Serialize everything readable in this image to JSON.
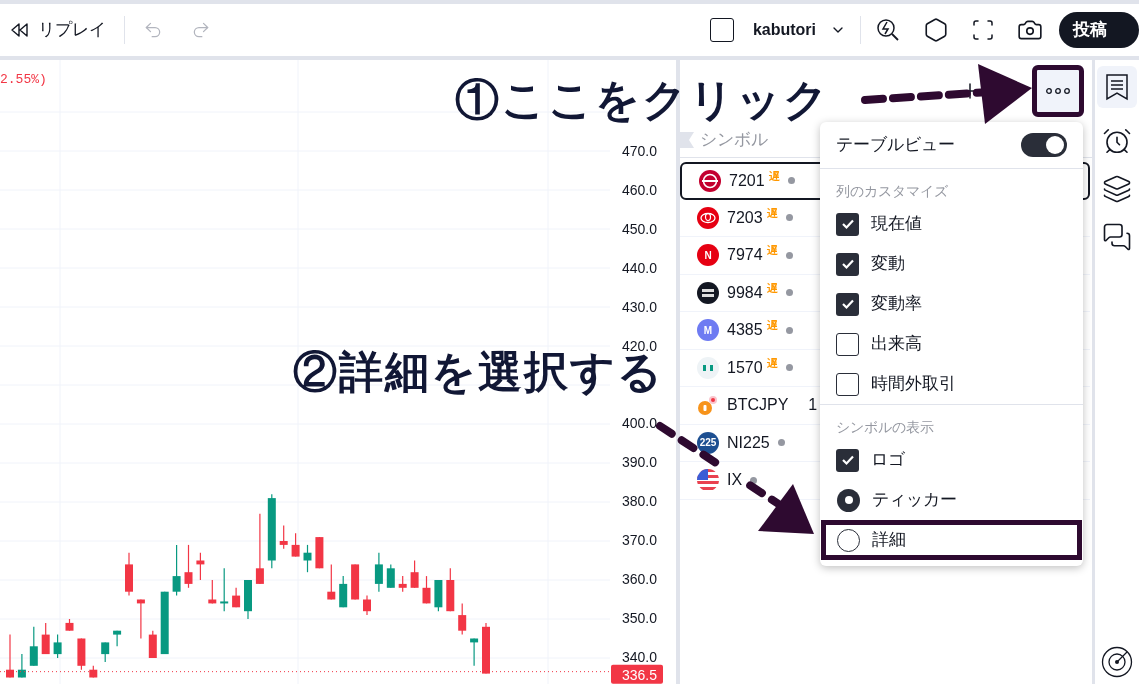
{
  "toolbar": {
    "replay_label": "リプレイ",
    "layout_name": "kabutori",
    "publish_button": "投稿"
  },
  "chart": {
    "change_text": "2.55%)",
    "price_axis_upper": [
      "470.0",
      "460.0",
      "450.0",
      "440.0",
      "430.0",
      "420.0"
    ],
    "price_axis_lower": [
      "400.0",
      "390.0",
      "380.0",
      "370.0",
      "360.0",
      "350.0",
      "340.0"
    ],
    "last_price": "336.5"
  },
  "watchlist": {
    "column_header": "シンボル",
    "more_button_outlined": true,
    "rows": [
      {
        "symbol": "7201",
        "delayed_tag": "遅",
        "status_dot": true,
        "selected": true,
        "logo": {
          "kind": "ring",
          "color": "#c3002f"
        }
      },
      {
        "symbol": "7203",
        "delayed_tag": "遅",
        "status_dot": true,
        "selected": false,
        "logo": {
          "kind": "emblem",
          "color": "#e60012"
        }
      },
      {
        "symbol": "7974",
        "delayed_tag": "遅",
        "status_dot": true,
        "selected": false,
        "logo": {
          "kind": "letter",
          "color": "#e60012",
          "text": "N"
        }
      },
      {
        "symbol": "9984",
        "delayed_tag": "遅",
        "status_dot": true,
        "selected": false,
        "logo": {
          "kind": "stripes",
          "color": "#131722"
        }
      },
      {
        "symbol": "4385",
        "delayed_tag": "遅",
        "status_dot": true,
        "selected": false,
        "logo": {
          "kind": "letter",
          "color": "#6e7bf2",
          "text": "M"
        }
      },
      {
        "symbol": "1570",
        "delayed_tag": "遅",
        "status_dot": true,
        "selected": false,
        "logo": {
          "kind": "bars",
          "color": "#eef3f6"
        }
      },
      {
        "symbol": "BTCJPY",
        "extra": "1",
        "status_dot": false,
        "selected": false,
        "logo": {
          "kind": "coin",
          "color": "#f7931a"
        }
      },
      {
        "symbol": "NI225",
        "status_dot": true,
        "selected": false,
        "logo": {
          "kind": "letter",
          "color": "#1d4f91",
          "text": "225"
        }
      },
      {
        "symbol": "IX",
        "status_dot": true,
        "selected": false,
        "logo": {
          "kind": "flag",
          "color": "#e9414f"
        }
      }
    ]
  },
  "menu": {
    "sections": [
      {
        "items": [
          {
            "kind": "toggle",
            "label": "テーブルビュー",
            "on": true
          }
        ]
      },
      {
        "title": "列のカスタマイズ",
        "items": [
          {
            "kind": "checkbox",
            "label": "現在値",
            "checked": true
          },
          {
            "kind": "checkbox",
            "label": "変動",
            "checked": true
          },
          {
            "kind": "checkbox",
            "label": "変動率",
            "checked": true
          },
          {
            "kind": "checkbox",
            "label": "出来高",
            "checked": false
          },
          {
            "kind": "checkbox",
            "label": "時間外取引",
            "checked": false
          }
        ]
      },
      {
        "title": "シンボルの表示",
        "items": [
          {
            "kind": "checkbox",
            "label": "ロゴ",
            "checked": true
          },
          {
            "kind": "radio",
            "label": "ティッカー",
            "selected": true,
            "outlined": false
          },
          {
            "kind": "radio",
            "label": "詳細",
            "selected": false,
            "outlined": true
          }
        ]
      }
    ]
  },
  "annotations": [
    {
      "text": "①ここをクリック"
    },
    {
      "text": "②詳細を選択する"
    }
  ]
}
